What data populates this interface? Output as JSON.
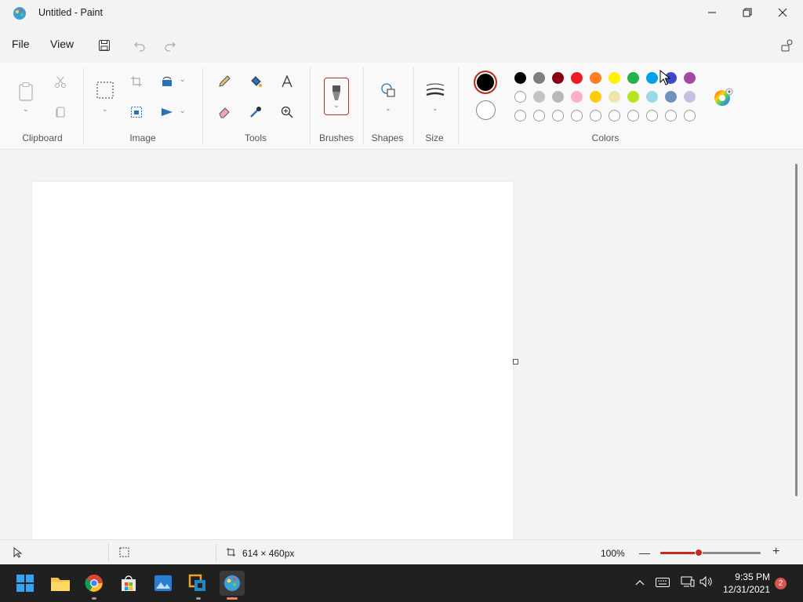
{
  "window": {
    "title": "Untitled - Paint"
  },
  "menu": {
    "file": "File",
    "view": "View"
  },
  "ribbon": {
    "groups": {
      "clipboard": "Clipboard",
      "image": "Image",
      "tools": "Tools",
      "brushes": "Brushes",
      "shapes": "Shapes",
      "size": "Size",
      "colors": "Colors"
    },
    "primary_color": "#000000",
    "secondary_color": "#ffffff",
    "palette_row1": [
      "#000000",
      "#7f7f7f",
      "#880015",
      "#ed1c24",
      "#ff7f27",
      "#fff200",
      "#22b14c",
      "#00a2e8",
      "#3f48cc",
      "#a349a4"
    ],
    "palette_row2": [
      "#ffffff",
      "#c3c3c3",
      "#b9b9b9",
      "#ffaec9",
      "#ffc90e",
      "#efe4b0",
      "#b5e61d",
      "#99d9ea",
      "#7092be",
      "#c8bfe7"
    ]
  },
  "status": {
    "canvas_size": "614 × 460px",
    "zoom": "100%"
  },
  "taskbar": {
    "time": "9:35 PM",
    "date": "12/31/2021",
    "notifications": "2"
  }
}
